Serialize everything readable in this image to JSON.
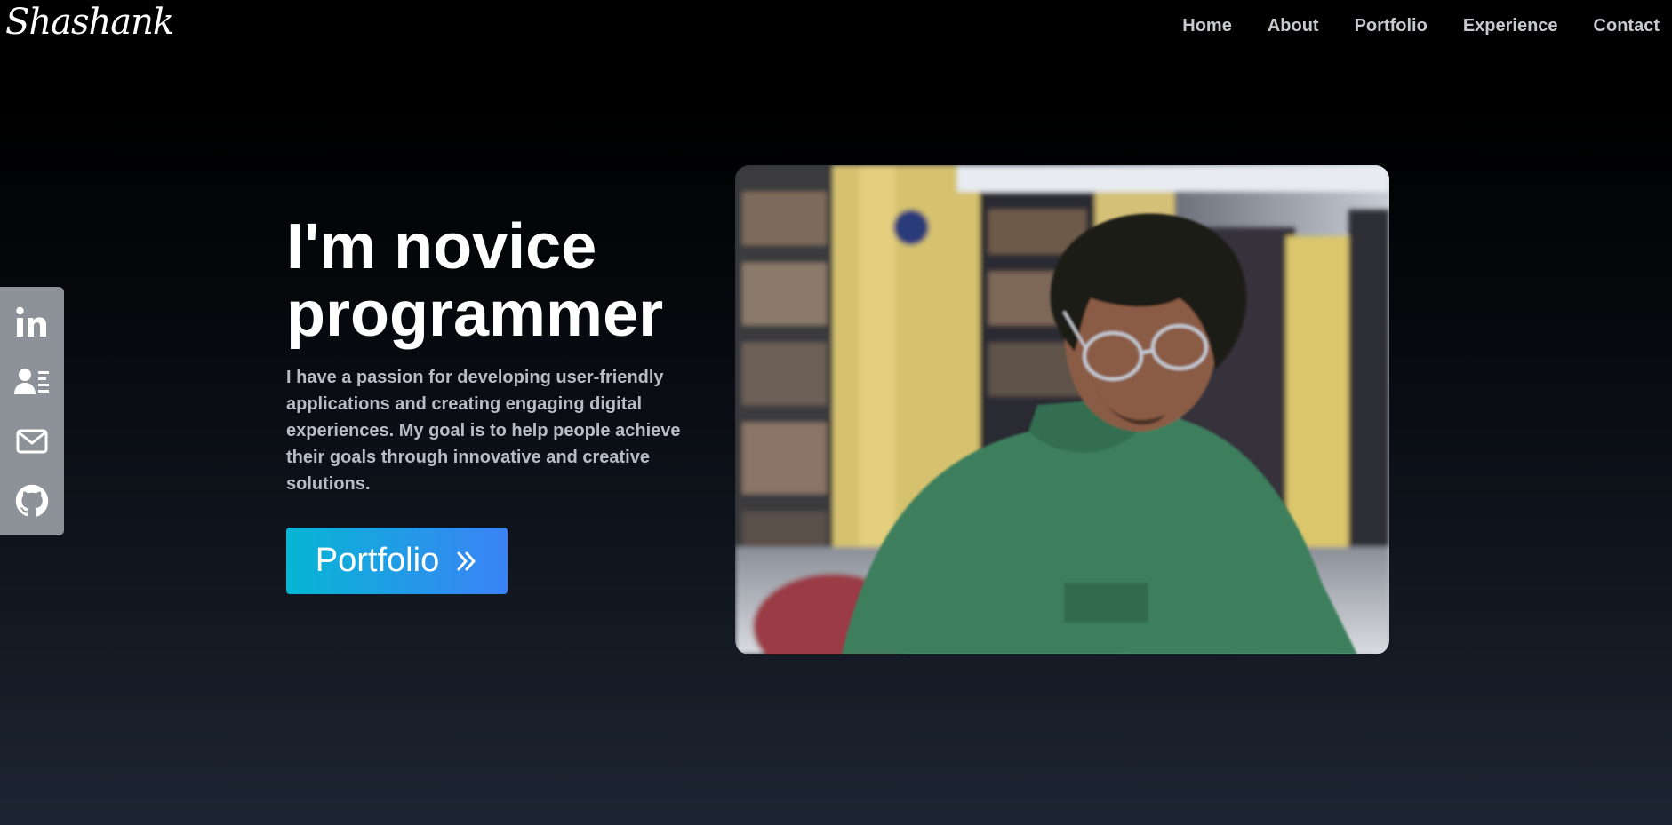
{
  "brand": {
    "logo_text": "Shashank"
  },
  "nav": {
    "items": [
      {
        "label": "Home"
      },
      {
        "label": "About"
      },
      {
        "label": "Portfolio"
      },
      {
        "label": "Experience"
      },
      {
        "label": "Contact"
      }
    ]
  },
  "social": {
    "items": [
      {
        "icon": "linkedin-icon"
      },
      {
        "icon": "resume-icon"
      },
      {
        "icon": "mail-icon"
      },
      {
        "icon": "github-icon"
      }
    ],
    "bg_color": "#8d9198"
  },
  "hero": {
    "title_line1": "I'm novice",
    "title_line2": "programmer",
    "description": "I have a passion for developing user-friendly applications and creating engaging digital experiences. My goal is to help people achieve their goals through innovative and creative solutions.",
    "cta_label": "Portfolio",
    "cta_gradient": [
      "#06b6d4",
      "#3b82f6"
    ]
  },
  "photo": {
    "subject": "young man with glasses in green t-shirt reading in a library"
  }
}
